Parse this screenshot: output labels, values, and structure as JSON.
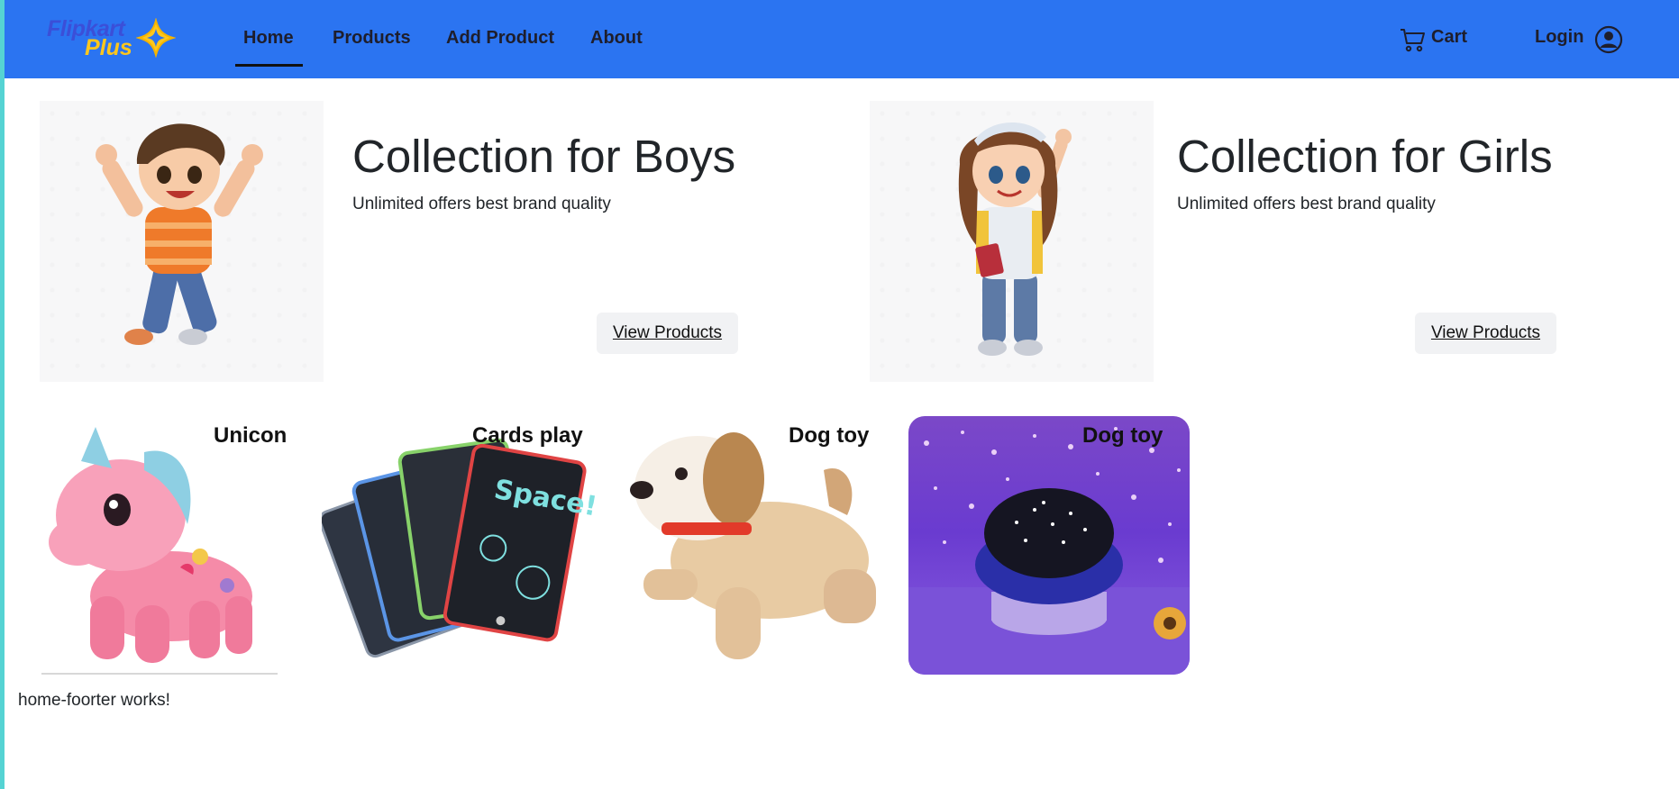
{
  "brand": {
    "line1": "Flipkart",
    "line2": "Plus"
  },
  "nav": {
    "home": "Home",
    "products": "Products",
    "add_product": "Add Product",
    "about": "About",
    "cart": "Cart",
    "login": "Login"
  },
  "collections": [
    {
      "title": "Collection for Boys",
      "subtitle": "Unlimited offers best brand quality",
      "button": "View Products"
    },
    {
      "title": "Collection for Girls",
      "subtitle": "Unlimited offers best brand quality",
      "button": "View Products"
    }
  ],
  "products": [
    {
      "name": "Unicon"
    },
    {
      "name": "Cards play"
    },
    {
      "name": "Dog toy"
    },
    {
      "name": "Dog toy"
    }
  ],
  "footer": {
    "text": "home-foorter works!"
  },
  "colors": {
    "navbar": "#2b74f1",
    "brand_blue": "#3b4fd8",
    "brand_yellow": "#ffc71c"
  }
}
